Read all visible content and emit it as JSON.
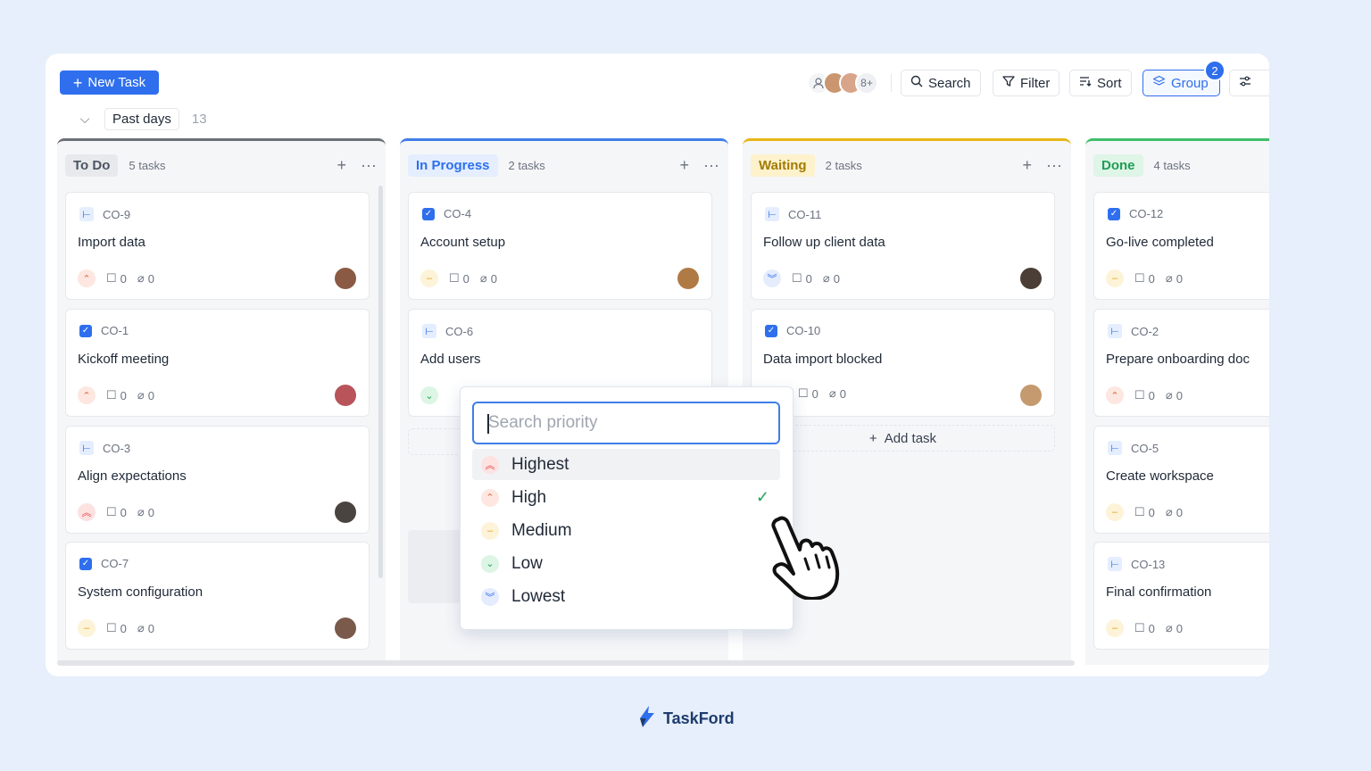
{
  "toolbar": {
    "new_task_label": "New Task",
    "avatars_more": "8+",
    "search_label": "Search",
    "filter_label": "Filter",
    "sort_label": "Sort",
    "group_label": "Group",
    "group_badge": "2"
  },
  "group_row": {
    "label": "Past days",
    "count": "13"
  },
  "columns": [
    {
      "name": "To Do",
      "count": "5 tasks",
      "accent": "#6b6f76",
      "cards": [
        {
          "id": "CO-9",
          "type": "subtask-icon",
          "title": "Import data",
          "priority": "high",
          "comments": "0",
          "attachments": "0"
        },
        {
          "id": "CO-1",
          "type": "checkbox-icon",
          "title": "Kickoff meeting",
          "priority": "high",
          "comments": "0",
          "attachments": "0"
        },
        {
          "id": "CO-3",
          "type": "subtask-icon",
          "title": "Align expectations",
          "priority": "highest",
          "comments": "0",
          "attachments": "0"
        },
        {
          "id": "CO-7",
          "type": "checkbox-icon",
          "title": "System configuration",
          "priority": "medium",
          "comments": "0",
          "attachments": "0"
        }
      ]
    },
    {
      "name": "In Progress",
      "count": "2 tasks",
      "accent": "#3f7ee8",
      "cards": [
        {
          "id": "CO-4",
          "type": "checkbox-icon",
          "title": "Account setup",
          "priority": "medium",
          "comments": "0",
          "attachments": "0"
        },
        {
          "id": "CO-6",
          "type": "subtask-icon",
          "title": "Add users",
          "priority": "low"
        }
      ]
    },
    {
      "name": "Waiting",
      "count": "2 tasks",
      "accent": "#e7b517",
      "cards": [
        {
          "id": "CO-11",
          "type": "subtask-icon",
          "title": "Follow up client data",
          "priority": "lowest",
          "comments": "0",
          "attachments": "0"
        },
        {
          "id": "CO-10",
          "type": "checkbox-icon",
          "title": "Data import blocked",
          "comments": "0",
          "attachments": "0"
        }
      ],
      "add_task_label": "Add task"
    },
    {
      "name": "Done",
      "count": "4 tasks",
      "accent": "#3fbf6b",
      "cards": [
        {
          "id": "CO-12",
          "type": "checkbox-icon",
          "title": "Go-live completed",
          "priority": "medium",
          "comments": "0",
          "attachments": "0"
        },
        {
          "id": "CO-2",
          "type": "subtask-icon",
          "title": "Prepare onboarding doc",
          "priority": "high",
          "comments": "0",
          "attachments": "0"
        },
        {
          "id": "CO-5",
          "type": "subtask-icon",
          "title": "Create workspace",
          "priority": "medium",
          "comments": "0",
          "attachments": "0"
        },
        {
          "id": "CO-13",
          "type": "subtask-icon",
          "title": "Final confirmation",
          "priority": "medium",
          "comments": "0",
          "attachments": "0"
        }
      ]
    }
  ],
  "priority_dropdown": {
    "placeholder": "Search priority",
    "options": [
      {
        "label": "Highest",
        "icon": "double-chevron-up-icon"
      },
      {
        "label": "High",
        "icon": "chevron-up-icon",
        "selected": true
      },
      {
        "label": "Medium",
        "icon": "dash-icon"
      },
      {
        "label": "Low",
        "icon": "chevron-down-icon"
      },
      {
        "label": "Lowest",
        "icon": "double-chevron-down-icon"
      }
    ]
  },
  "brand": {
    "name": "TaskFord"
  }
}
